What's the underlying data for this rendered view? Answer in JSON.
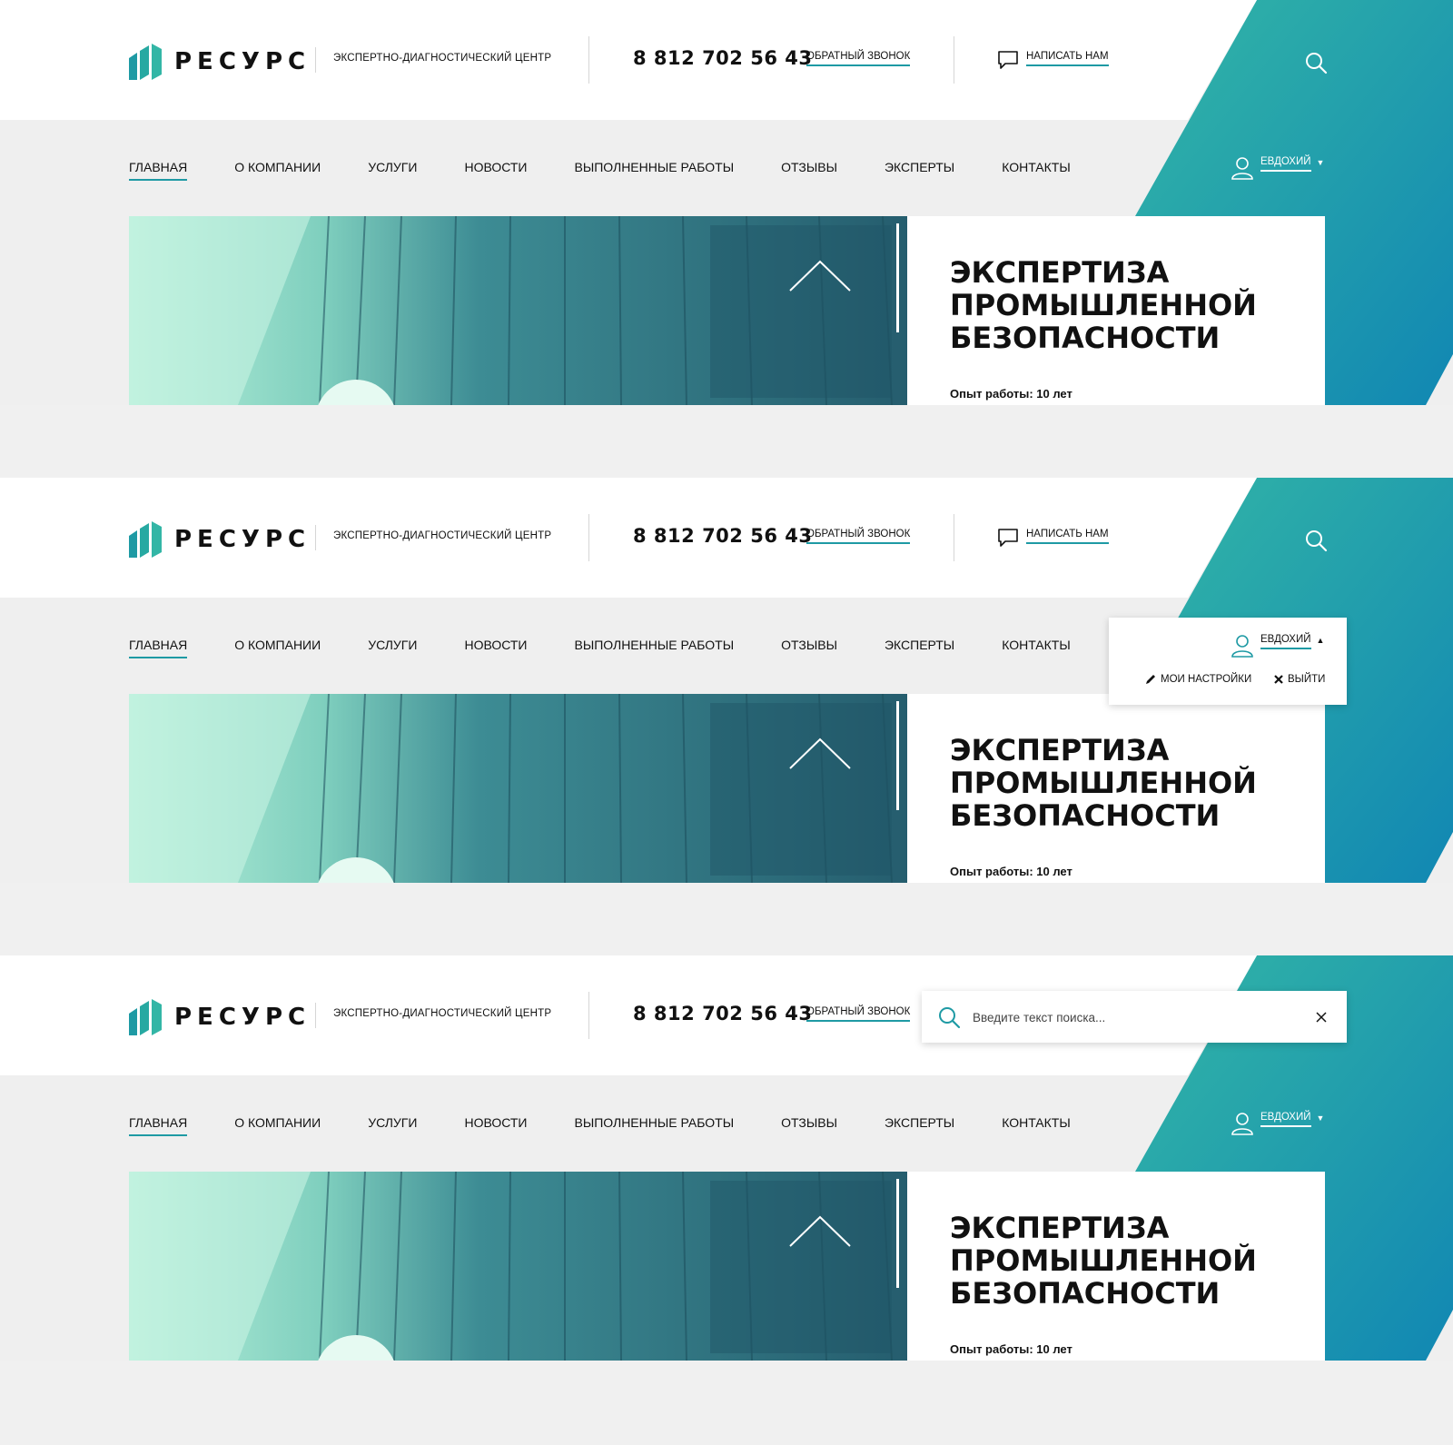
{
  "brand": {
    "name": "РЕСУРС",
    "tagline": "ЭКСПЕРТНО-ДИАГНОСТИЧЕСКИЙ ЦЕНТР"
  },
  "contact": {
    "phone": "8 812 702 56 43",
    "callback_label": "ОБРАТНЫЙ ЗВОНОК",
    "write_label": "НАПИСАТЬ НАМ"
  },
  "nav": {
    "items": [
      "ГЛАВНАЯ",
      "О КОМПАНИИ",
      "УСЛУГИ",
      "НОВОСТИ",
      "ВЫПОЛНЕННЫЕ РАБОТЫ",
      "ОТЗЫВЫ",
      "ЭКСПЕРТЫ",
      "КОНТАКТЫ"
    ],
    "active": "ГЛАВНАЯ"
  },
  "user": {
    "name": "ЕВДОХИЙ",
    "menu": {
      "settings_label": "МОИ НАСТРОЙКИ",
      "logout_label": "ВЫЙТИ"
    }
  },
  "hero": {
    "title_lines": [
      "ЭКСПЕРТИЗА",
      "ПРОМЫШЛЕННОЙ",
      "БЕЗОПАСНОСТИ"
    ],
    "experience": "Опыт работы: 10 лет"
  },
  "search": {
    "placeholder": "Введите текст поиска..."
  },
  "icons": {
    "logo": "ribbon-logo-icon",
    "chat": "chat-bubble-icon",
    "search": "search-icon",
    "user": "user-icon",
    "caret_down": "caret-down-icon",
    "caret_up": "caret-up-icon",
    "pencil": "pencil-icon",
    "close": "close-icon",
    "chevron_up": "chevron-up-icon"
  },
  "colors": {
    "accent": "#1e9aa4",
    "teal_light": "#2fb3a7",
    "teal_dark": "#1489b3",
    "background": "#efefef"
  }
}
